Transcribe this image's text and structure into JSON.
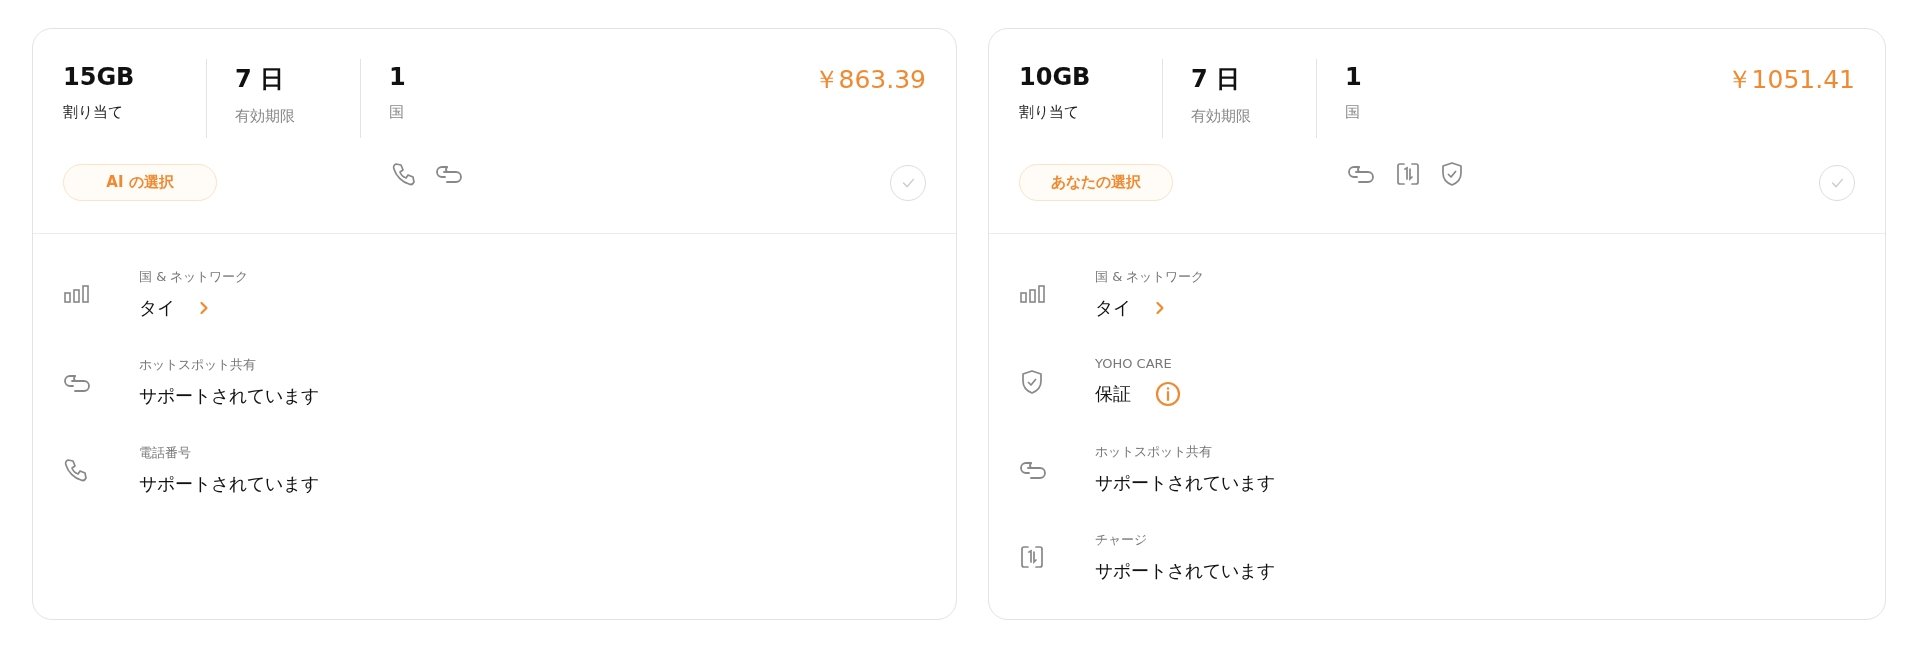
{
  "plans": [
    {
      "allocation": "15GB",
      "allocation_label": "割り当て",
      "validity": "7 日",
      "validity_label": "有効期限",
      "countries": "1",
      "countries_label": "国",
      "price": "￥863.39",
      "badge": "AI の選択",
      "selected": false,
      "features": [
        {
          "kind": "phone"
        },
        {
          "kind": "hotspot"
        }
      ],
      "details": [
        {
          "kind": "network",
          "label": "国 & ネットワーク",
          "value": "タイ",
          "expandable": true
        },
        {
          "kind": "hotspot",
          "label": "ホットスポット共有",
          "value": "サポートされています"
        },
        {
          "kind": "phone",
          "label": "電話番号",
          "value": "サポートされています"
        }
      ]
    },
    {
      "allocation": "10GB",
      "allocation_label": "割り当て",
      "validity": "7 日",
      "validity_label": "有効期限",
      "countries": "1",
      "countries_label": "国",
      "price": "￥1051.41",
      "badge": "あなたの選択",
      "selected": false,
      "features": [
        {
          "kind": "hotspot"
        },
        {
          "kind": "charge"
        },
        {
          "kind": "care"
        }
      ],
      "details": [
        {
          "kind": "network",
          "label": "国 & ネットワーク",
          "value": "タイ",
          "expandable": true
        },
        {
          "kind": "care",
          "label": "YOHO CARE",
          "value": "保証",
          "has_info": true
        },
        {
          "kind": "hotspot",
          "label": "ホットスポット共有",
          "value": "サポートされています"
        },
        {
          "kind": "charge",
          "label": "チャージ",
          "value": "サポートされています"
        }
      ]
    }
  ]
}
